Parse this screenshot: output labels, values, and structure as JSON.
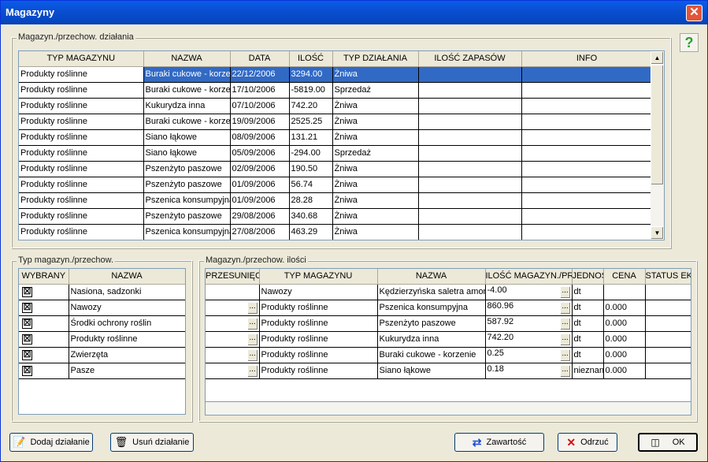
{
  "window": {
    "title": "Magazyny",
    "close_label": "✕",
    "help_label": "?"
  },
  "top_group": {
    "legend": "Magazyn./przechow. działania",
    "columns": [
      "TYP MAGAZYNU",
      "NAZWA",
      "DATA",
      "ILOŚĆ",
      "TYP DZIAŁANIA",
      "ILOŚĆ ZAPASÓW",
      "INFO"
    ],
    "rows": [
      [
        "Produkty roślinne",
        "Buraki cukowe - korzenie",
        "22/12/2006",
        "3294.00",
        "Żniwa",
        "",
        ""
      ],
      [
        "Produkty roślinne",
        "Buraki cukowe - korzenie",
        "17/10/2006",
        "-5819.00",
        "Sprzedaż",
        "",
        ""
      ],
      [
        "Produkty roślinne",
        "Kukurydza inna",
        "07/10/2006",
        "742.20",
        "Żniwa",
        "",
        ""
      ],
      [
        "Produkty roślinne",
        "Buraki cukowe - korzenie",
        "19/09/2006",
        "2525.25",
        "Żniwa",
        "",
        ""
      ],
      [
        "Produkty roślinne",
        "Siano łąkowe",
        "08/09/2006",
        "131.21",
        "Żniwa",
        "",
        ""
      ],
      [
        "Produkty roślinne",
        "Siano łąkowe",
        "05/09/2006",
        "-294.00",
        "Sprzedaż",
        "",
        ""
      ],
      [
        "Produkty roślinne",
        "Pszenżyto paszowe",
        "02/09/2006",
        "190.50",
        "Żniwa",
        "",
        ""
      ],
      [
        "Produkty roślinne",
        "Pszenżyto paszowe",
        "01/09/2006",
        "56.74",
        "Żniwa",
        "",
        ""
      ],
      [
        "Produkty roślinne",
        "Pszenica konsumpyjna",
        "01/09/2006",
        "28.28",
        "Żniwa",
        "",
        ""
      ],
      [
        "Produkty roślinne",
        "Pszenżyto paszowe",
        "29/08/2006",
        "340.68",
        "Żniwa",
        "",
        ""
      ],
      [
        "Produkty roślinne",
        "Pszenica konsumpyjna",
        "27/08/2006",
        "463.29",
        "Żniwa",
        "",
        ""
      ]
    ]
  },
  "left_group": {
    "legend": "Typ magazyn./przechow.",
    "columns": [
      "WYBRANY",
      "NAZWA"
    ],
    "rows": [
      {
        "checked": "☒",
        "name": "Nasiona, sadzonki"
      },
      {
        "checked": "☒",
        "name": "Nawozy"
      },
      {
        "checked": "☒",
        "name": "Środki ochrony roślin"
      },
      {
        "checked": "☒",
        "name": "Produkty roślinne"
      },
      {
        "checked": "☒",
        "name": "Zwierzęta"
      },
      {
        "checked": "☒",
        "name": "Pasze"
      }
    ]
  },
  "right_group": {
    "legend": "Magazyn./przechow. ilości",
    "columns": [
      "PRZESUNIĘCIE",
      "TYP MAGAZYNU",
      "NAZWA",
      "ILOŚĆ MAGAZYN./PRZECHOW.",
      "JEDNOSTKI",
      "CENA",
      "STATUS EKOLOGICZNY"
    ],
    "rows": [
      {
        "move": "",
        "type": "Nawozy",
        "name": "Kędzierzyńska saletra amonowa",
        "qty": "-4.00",
        "unit": "dt",
        "price": "",
        "eco": ""
      },
      {
        "move": "...",
        "type": "Produkty roślinne",
        "name": "Pszenica konsumpyjna",
        "qty": "860.96",
        "unit": "dt",
        "price": "0.000",
        "eco": ""
      },
      {
        "move": "...",
        "type": "Produkty roślinne",
        "name": "Pszenżyto paszowe",
        "qty": "587.92",
        "unit": "dt",
        "price": "0.000",
        "eco": ""
      },
      {
        "move": "...",
        "type": "Produkty roślinne",
        "name": "Kukurydza inna",
        "qty": "742.20",
        "unit": "dt",
        "price": "0.000",
        "eco": ""
      },
      {
        "move": "...",
        "type": "Produkty roślinne",
        "name": "Buraki cukowe - korzenie",
        "qty": "0.25",
        "unit": "dt",
        "price": "0.000",
        "eco": ""
      },
      {
        "move": "...",
        "type": "Produkty roślinne",
        "name": "Siano łąkowe",
        "qty": "0.18",
        "unit": "nieznany",
        "price": "0.000",
        "eco": ""
      }
    ],
    "dots_label": "..."
  },
  "buttons": {
    "add": "Dodaj działanie",
    "remove": "Usuń działanie",
    "content": "Zawartość",
    "cancel": "Odrzuć",
    "ok": "OK"
  },
  "icons": {
    "add": "add-document-icon",
    "remove": "trash-icon",
    "content": "swap-arrows-icon",
    "cancel": "red-x-icon",
    "ok": "ok-icon"
  }
}
